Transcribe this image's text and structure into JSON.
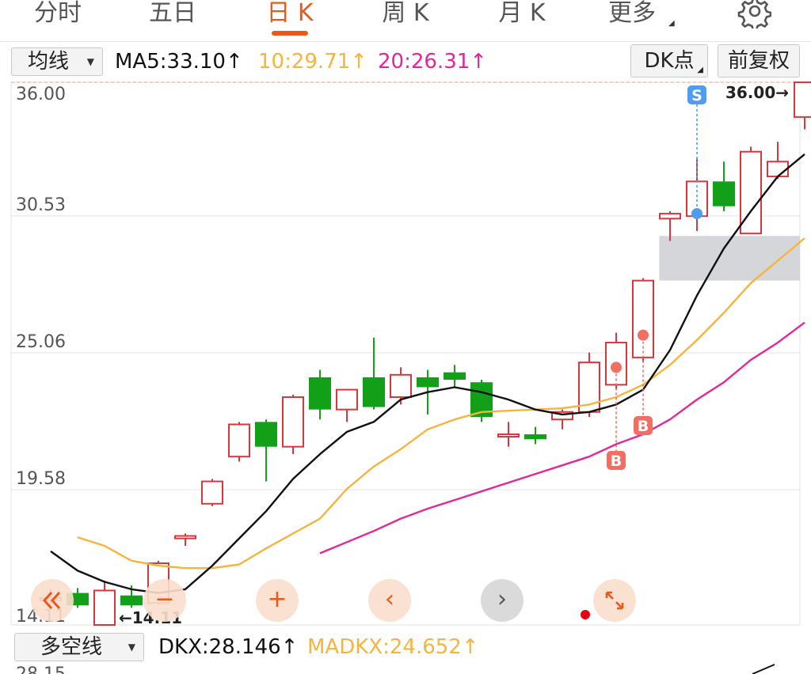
{
  "tabs": [
    {
      "label": "分时",
      "active": false
    },
    {
      "label": "五日",
      "active": false
    },
    {
      "label": "日 K",
      "active": true
    },
    {
      "label": "周 K",
      "active": false
    },
    {
      "label": "月 K",
      "active": false
    },
    {
      "label": "更多",
      "active": false
    }
  ],
  "toolbar": {
    "ma_selector": "均线",
    "ma5": "MA5:33.10",
    "ma10": "10:29.71",
    "ma20": "20:26.31",
    "dk_button": "DK点",
    "adjust_button": "前复权"
  },
  "colors": {
    "up": "#d9363e",
    "down": "#12a019",
    "ma5": "#111111",
    "ma10": "#f5b53d",
    "ma20": "#e0289a",
    "accent": "#e8591c",
    "marker_b": "#f26d62",
    "marker_s": "#4f9df0",
    "zone": "#d2d4d8"
  },
  "chart_data": {
    "type": "candlestick",
    "y_ticks": [
      "36.00",
      "30.53",
      "25.06",
      "19.58",
      "14.11"
    ],
    "max_label": "36.00→",
    "min_label": "←14.11",
    "price_range": [
      14.11,
      36.0
    ],
    "candles": [
      {
        "o": 15.2,
        "c": 15.2,
        "h": 15.6,
        "l": 14.8
      },
      {
        "o": 15.4,
        "c": 14.9,
        "h": 15.6,
        "l": 14.8
      },
      {
        "o": 14.11,
        "c": 15.5,
        "h": 15.9,
        "l": 14.11
      },
      {
        "o": 15.3,
        "c": 14.9,
        "h": 15.7,
        "l": 14.8
      },
      {
        "o": 15.0,
        "c": 16.6,
        "h": 16.7,
        "l": 14.9
      },
      {
        "o": 17.6,
        "c": 17.7,
        "h": 17.8,
        "l": 17.3
      },
      {
        "o": 19.0,
        "c": 19.9,
        "h": 20.0,
        "l": 18.9
      },
      {
        "o": 20.9,
        "c": 22.2,
        "h": 22.3,
        "l": 20.7
      },
      {
        "o": 22.3,
        "c": 21.3,
        "h": 22.4,
        "l": 19.9
      },
      {
        "o": 21.3,
        "c": 23.3,
        "h": 23.4,
        "l": 21.0
      },
      {
        "o": 24.1,
        "c": 22.8,
        "h": 24.4,
        "l": 22.4
      },
      {
        "o": 22.8,
        "c": 23.6,
        "h": 23.6,
        "l": 22.3
      },
      {
        "o": 24.1,
        "c": 22.9,
        "h": 25.7,
        "l": 22.8
      },
      {
        "o": 23.3,
        "c": 24.2,
        "h": 24.5,
        "l": 23.0
      },
      {
        "o": 24.1,
        "c": 23.7,
        "h": 24.4,
        "l": 22.6
      },
      {
        "o": 24.3,
        "c": 24.0,
        "h": 24.6,
        "l": 23.7
      },
      {
        "o": 23.9,
        "c": 22.5,
        "h": 24.0,
        "l": 22.3
      },
      {
        "o": 21.8,
        "c": 21.8,
        "h": 22.3,
        "l": 21.3
      },
      {
        "o": 21.8,
        "c": 21.6,
        "h": 22.1,
        "l": 21.4
      },
      {
        "o": 22.4,
        "c": 22.7,
        "h": 22.8,
        "l": 22.0
      },
      {
        "o": 22.7,
        "c": 24.7,
        "h": 25.1,
        "l": 22.5
      },
      {
        "o": 23.8,
        "c": 25.5,
        "h": 25.9,
        "l": 23.6
      },
      {
        "o": 24.9,
        "c": 28.0,
        "h": 28.1,
        "l": 24.7
      },
      {
        "o": 30.5,
        "c": 30.7,
        "h": 30.8,
        "l": 29.6
      },
      {
        "o": 30.6,
        "c": 32.0,
        "h": 32.9,
        "l": 30.0
      },
      {
        "o": 32.0,
        "c": 31.0,
        "h": 32.8,
        "l": 30.8
      },
      {
        "o": 29.9,
        "c": 33.2,
        "h": 33.4,
        "l": 29.9
      },
      {
        "o": 32.2,
        "c": 32.8,
        "h": 33.6,
        "l": 32.1
      },
      {
        "o": 34.6,
        "c": 36.0,
        "h": 36.0,
        "l": 34.1
      }
    ],
    "ma5": [
      17.08,
      16.3,
      15.85,
      15.55,
      15.4,
      15.55,
      16.5,
      17.6,
      18.7,
      20.0,
      21.0,
      21.9,
      22.3,
      23.2,
      23.5,
      23.7,
      23.5,
      23.2,
      22.8,
      22.6,
      22.7,
      23.0,
      23.6,
      25.2,
      27.4,
      29.3,
      30.8,
      32.2,
      33.1
    ],
    "ma10": [
      17.65,
      17.3,
      16.7,
      16.5,
      16.4,
      16.4,
      16.55,
      17.2,
      17.8,
      18.4,
      19.6,
      20.5,
      21.2,
      22.0,
      22.4,
      22.7,
      22.75,
      22.8,
      22.85,
      23.0,
      23.3,
      23.8,
      24.6,
      25.6,
      26.7,
      27.9,
      28.8,
      29.71
    ],
    "ma20": [
      17.0,
      17.45,
      17.9,
      18.4,
      18.8,
      19.15,
      19.5,
      19.85,
      20.2,
      20.55,
      20.9,
      21.4,
      21.8,
      22.4,
      23.2,
      23.9,
      24.8,
      25.5,
      26.31
    ],
    "ma10_start": 1,
    "ma20_start": 10,
    "signals": [
      {
        "type": "B",
        "index": 21,
        "at": 24.5
      },
      {
        "type": "B",
        "index": 22,
        "at": 25.8
      },
      {
        "type": "S",
        "index": 24,
        "at": 30.7
      }
    ],
    "zone": {
      "from_index": 22.6,
      "low": 28.0,
      "high": 29.8
    }
  },
  "controls": {
    "zoom_out": "−",
    "zoom_in": "+",
    "prev": "‹",
    "next": "›",
    "expand": "⤡"
  },
  "dkx": {
    "selector": "多空线",
    "dkx": "DKX:28.146",
    "madkx": "MADKX:24.652",
    "partial_tick": "28.15"
  }
}
